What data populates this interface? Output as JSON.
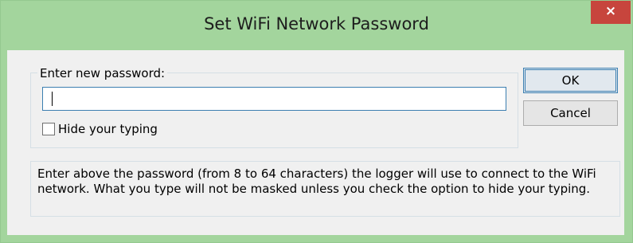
{
  "window": {
    "title": "Set WiFi Network Password",
    "close_label": "×"
  },
  "group": {
    "legend": "Enter new password:",
    "password_value": "",
    "hide_typing_label": "Hide your typing",
    "hide_typing_checked": false
  },
  "buttons": {
    "ok_label": "OK",
    "cancel_label": "Cancel"
  },
  "info": {
    "text": "Enter above the password (from 8 to 64 characters) the logger will use to connect to the WiFi network.  What you type will not be masked unless you check the option to hide your typing."
  },
  "colors": {
    "titlebar": "#a3d59d",
    "close_button": "#c7453d",
    "client_background": "#f0f0f0",
    "input_focus_border": "#3c7fb1"
  }
}
